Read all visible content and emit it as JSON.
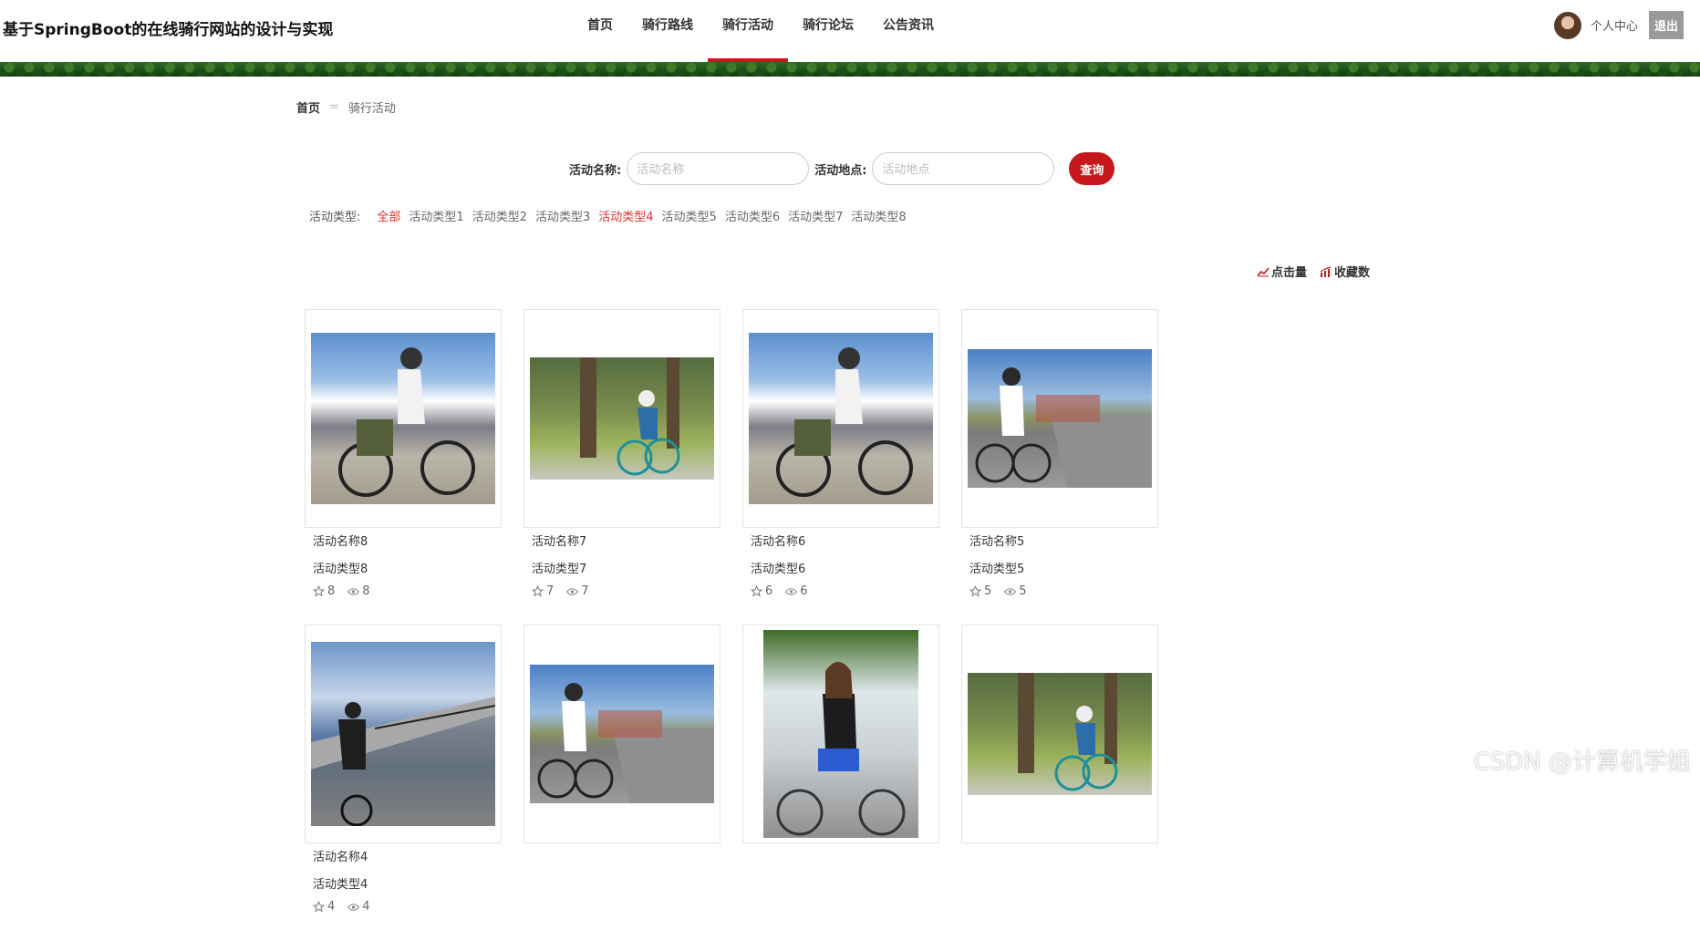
{
  "header": {
    "site_title": "基于SpringBoot的在线骑行网站的设计与实现",
    "nav": [
      {
        "label": "首页",
        "active": false
      },
      {
        "label": "骑行路线",
        "active": false
      },
      {
        "label": "骑行活动",
        "active": true
      },
      {
        "label": "骑行论坛",
        "active": false
      },
      {
        "label": "公告资讯",
        "active": false
      }
    ],
    "user_center": "个人中心",
    "logout": "退出"
  },
  "breadcrumb": {
    "home": "首页",
    "separator": "=",
    "current": "骑行活动"
  },
  "search": {
    "name_label": "活动名称:",
    "name_placeholder": "活动名称",
    "name_value": "",
    "location_label": "活动地点:",
    "location_placeholder": "活动地点",
    "location_value": "",
    "button": "查询"
  },
  "filter": {
    "label": "活动类型:",
    "options": [
      "全部",
      "活动类型1",
      "活动类型2",
      "活动类型3",
      "活动类型4",
      "活动类型5",
      "活动类型6",
      "活动类型7",
      "活动类型8"
    ],
    "highlighted": [
      "全部",
      "活动类型4"
    ]
  },
  "sort": {
    "clicks": "点击量",
    "favorites": "收藏数"
  },
  "cards": [
    {
      "name": "活动名称8",
      "type": "活动类型8",
      "favorites": "8",
      "views": "8",
      "picture": "mountain"
    },
    {
      "name": "活动名称7",
      "type": "活动类型7",
      "favorites": "7",
      "views": "7",
      "picture": "forest"
    },
    {
      "name": "活动名称6",
      "type": "活动类型6",
      "favorites": "6",
      "views": "6",
      "picture": "mountain"
    },
    {
      "name": "活动名称5",
      "type": "活动类型5",
      "favorites": "5",
      "views": "5",
      "picture": "road"
    },
    {
      "name": "活动名称4",
      "type": "活动类型4",
      "favorites": "4",
      "views": "4",
      "picture": "lake"
    },
    {
      "name": "",
      "type": "",
      "favorites": "",
      "views": "",
      "picture": "road"
    },
    {
      "name": "",
      "type": "",
      "favorites": "",
      "views": "",
      "picture": "girl"
    },
    {
      "name": "",
      "type": "",
      "favorites": "",
      "views": "",
      "picture": "forest"
    }
  ],
  "watermark": "CSDN @计算机学姐",
  "colors": {
    "accent": "#c8161d",
    "highlight": "#e03030",
    "logout_bg": "#9a9a9a"
  }
}
